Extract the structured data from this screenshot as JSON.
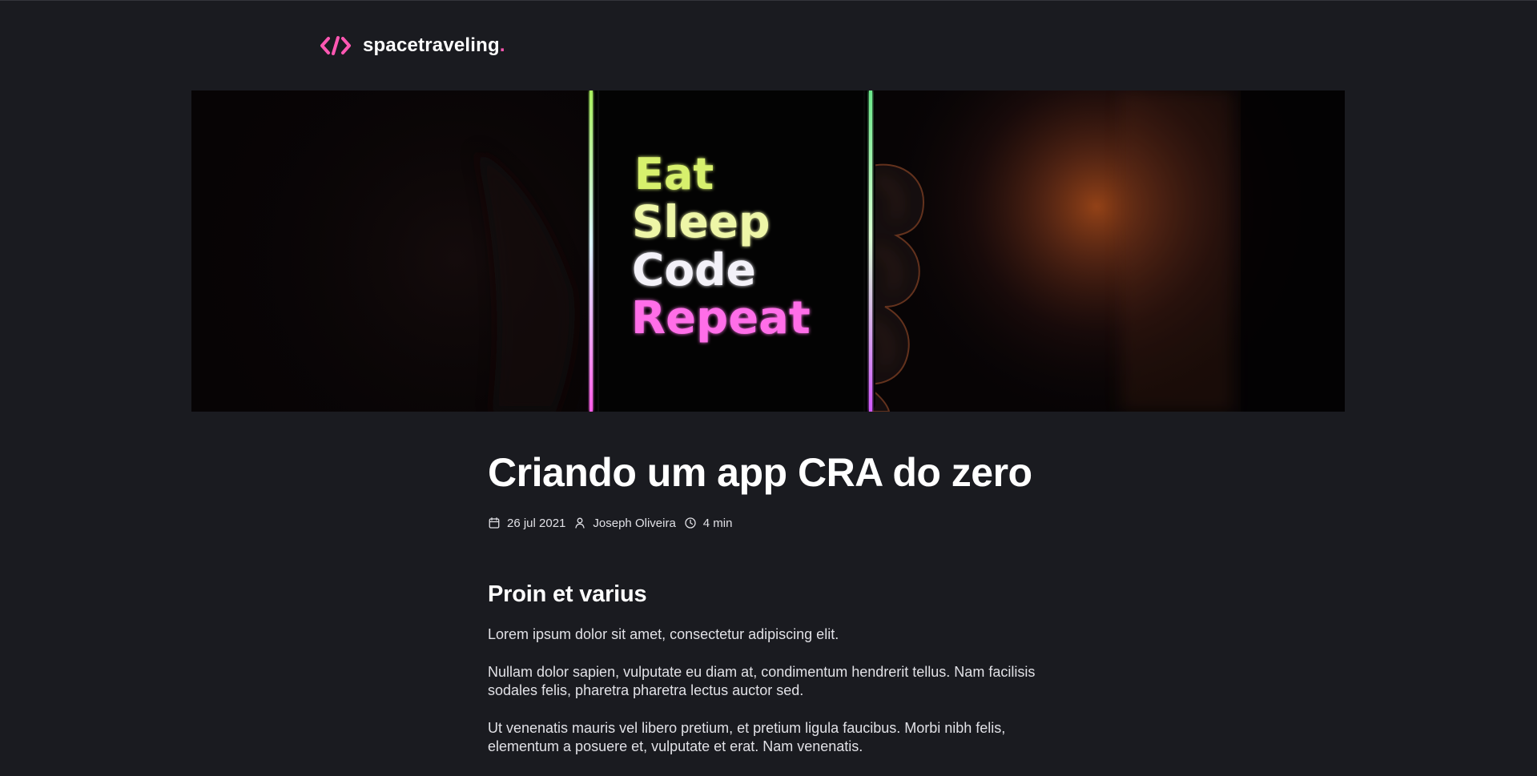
{
  "header": {
    "brand_name": "spacetraveling",
    "brand_dot": ".",
    "logo_icon": "code-brackets-icon",
    "colors": {
      "accent": "#ff57b2",
      "background": "#1a1b20",
      "text": "#ffffff",
      "muted_text": "#e1e1e6"
    }
  },
  "hero": {
    "image_text": [
      "Eat",
      "Sleep",
      "Code",
      "Repeat"
    ],
    "image_colors": [
      "#d7f06d",
      "#eef6a7",
      "#f3f1f8",
      "#ff6ee8"
    ]
  },
  "post": {
    "title": "Criando um app CRA do zero",
    "date": "26 jul 2021",
    "author": "Joseph Oliveira",
    "reading_time": "4 min",
    "icons": [
      "calendar-icon",
      "user-icon",
      "clock-icon"
    ],
    "sections": [
      {
        "heading": "Proin et varius",
        "paragraphs": [
          "Lorem ipsum dolor sit amet, consectetur adipiscing elit.",
          "Nullam dolor sapien, vulputate eu diam at, condimentum hendrerit tellus. Nam facilisis sodales felis, pharetra pharetra lectus auctor sed.",
          "Ut venenatis mauris vel libero pretium, et pretium ligula faucibus. Morbi nibh felis, elementum a posuere et, vulputate et erat. Nam venenatis."
        ]
      }
    ]
  }
}
